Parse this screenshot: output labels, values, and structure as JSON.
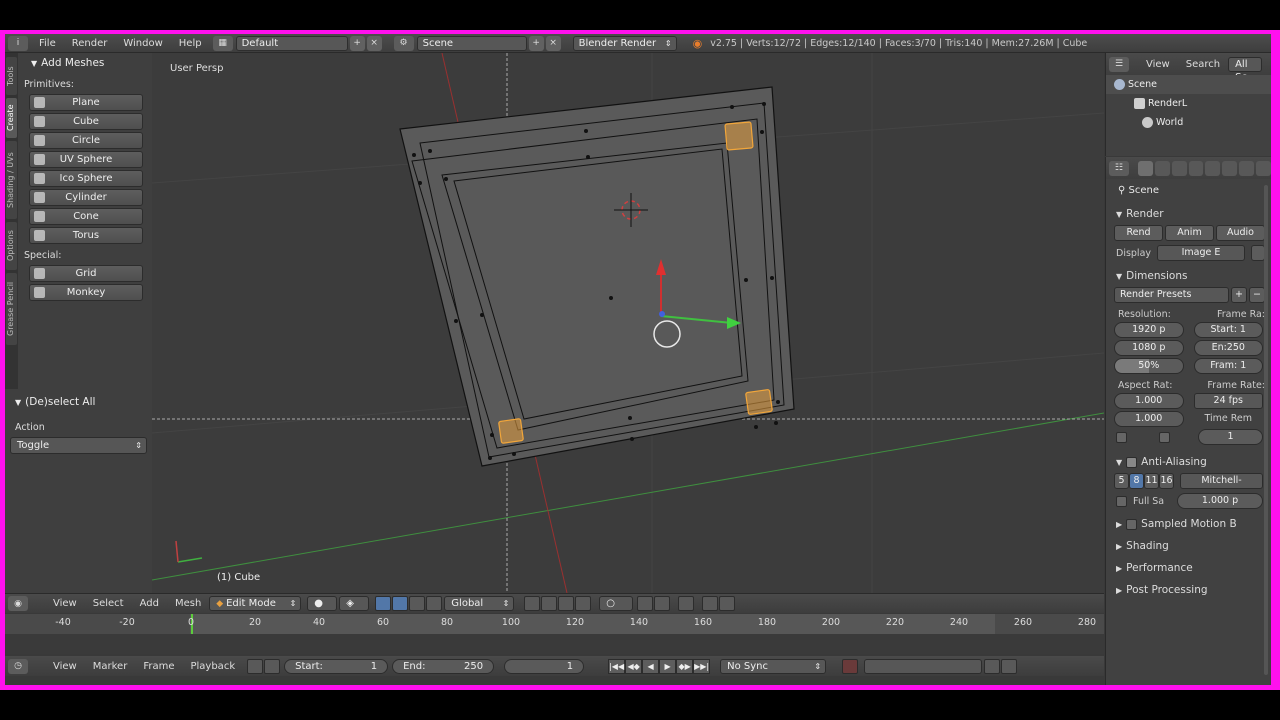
{
  "topbar": {
    "menus": [
      "File",
      "Render",
      "Window",
      "Help"
    ],
    "screen_layout": "Default",
    "scene": "Scene",
    "engine": "Blender Render",
    "info": "v2.75 | Verts:12/72 | Edges:12/140 | Faces:3/70 | Tris:140 | Mem:27.26M | Cube"
  },
  "toolshelf": {
    "tabs": [
      "Tools",
      "Create",
      "Shading / UVs",
      "Options",
      "Grease Pencil"
    ],
    "panel_title": "Add Meshes",
    "primitives_label": "Primitives:",
    "primitives": [
      "Plane",
      "Cube",
      "Circle",
      "UV Sphere",
      "Ico Sphere",
      "Cylinder",
      "Cone",
      "Torus"
    ],
    "special_label": "Special:",
    "special": [
      "Grid",
      "Monkey"
    ],
    "operator_title": "(De)select All",
    "action_label": "Action",
    "action_value": "Toggle"
  },
  "viewport": {
    "view_label": "User Persp",
    "object_label": "(1) Cube"
  },
  "view3d_header": {
    "menus": [
      "View",
      "Select",
      "Add",
      "Mesh"
    ],
    "mode": "Edit Mode",
    "orientation": "Global"
  },
  "timeline": {
    "ticks": [
      "-40",
      "-20",
      "0",
      "20",
      "40",
      "60",
      "80",
      "100",
      "120",
      "140",
      "160",
      "180",
      "200",
      "220",
      "240",
      "260",
      "280"
    ],
    "menus": [
      "View",
      "Marker",
      "Frame",
      "Playback"
    ],
    "start_label": "Start:",
    "start_value": "1",
    "end_label": "End:",
    "end_value": "250",
    "current_frame": "1",
    "sync": "No Sync"
  },
  "outliner": {
    "menus": [
      "View",
      "Search",
      "All Sc"
    ],
    "items": [
      "Scene",
      "RenderL",
      "World"
    ]
  },
  "properties": {
    "context": "Scene",
    "render_section": "Render",
    "render_buttons": [
      "Rend",
      "Anim",
      "Audio"
    ],
    "display_label": "Display",
    "display_value": "Image E",
    "dimensions_section": "Dimensions",
    "render_presets": "Render Presets",
    "resolution_label": "Resolution:",
    "frame_range_label": "Frame Ra:",
    "res_x": "1920 p",
    "res_y": "1080 p",
    "res_pct": "50%",
    "start_frame": "Start: 1",
    "end_frame": "En:250",
    "frame_step": "Fram: 1",
    "aspect_label": "Aspect Rat:",
    "frame_rate_label": "Frame Rate:",
    "aspect_x": "1.000",
    "aspect_y": "1.000",
    "fps": "24 fps",
    "time_remap_label": "Time Rem",
    "time_remap_value": "1",
    "aa_section": "Anti-Aliasing",
    "aa_samples": [
      "5",
      "8",
      "11",
      "16"
    ],
    "aa_filter": "Mitchell-",
    "full_sample": "Full Sa",
    "filter_size": "1.000 p",
    "motion_blur": "Sampled Motion B",
    "shading": "Shading",
    "performance": "Performance",
    "post_processing": "Post Processing"
  },
  "colors": {
    "frame_border": "#ff10ee",
    "x_axis": "#c84040",
    "y_axis": "#4fb04f",
    "selection": "#f0a030"
  }
}
